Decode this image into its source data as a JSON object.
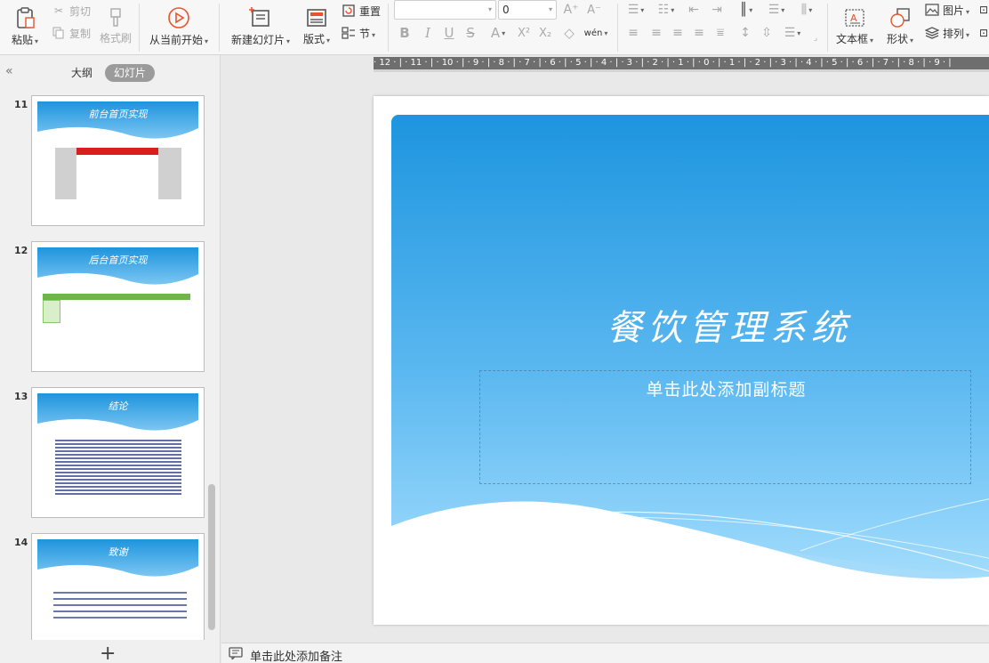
{
  "ribbon": {
    "paste": "粘贴",
    "cut": "剪切",
    "copy": "复制",
    "format_painter": "格式刷",
    "from_current": "从当前开始",
    "new_slide": "新建幻灯片",
    "layout": "版式",
    "reset": "重置",
    "section": "节",
    "font_name": "",
    "font_size": "0",
    "textbox": "文本框",
    "shape": "形状",
    "picture": "图片",
    "arrange": "排列"
  },
  "panel": {
    "tab_outline": "大纲",
    "tab_slides": "幻灯片",
    "thumbnails": [
      {
        "num": "11",
        "title": "前台首页实现"
      },
      {
        "num": "12",
        "title": "后台首页实现"
      },
      {
        "num": "13",
        "title": "结论"
      },
      {
        "num": "14",
        "title": "致谢"
      }
    ]
  },
  "ruler": {
    "text": "· 12 · | · 11 · | · 10 · | · 9 · | · 8 · | · 7 · | · 6 · | · 5 · | · 4 · | · 3 · | · 2 · | · 1 · | · 0 · | · 1 · | · 2 · | · 3 · | · 4 · | · 5 · | · 6 · | · 7 · | · 8 · | · 9 · |"
  },
  "slide": {
    "title": "餐饮管理系统",
    "subtitle_placeholder": "单击此处添加副标题"
  },
  "notes": {
    "placeholder": "单击此处添加备注"
  },
  "colors": {
    "slide_blue_top": "#1d95df",
    "slide_blue_bottom": "#b9e5fc",
    "accent_orange": "#e8532b"
  }
}
